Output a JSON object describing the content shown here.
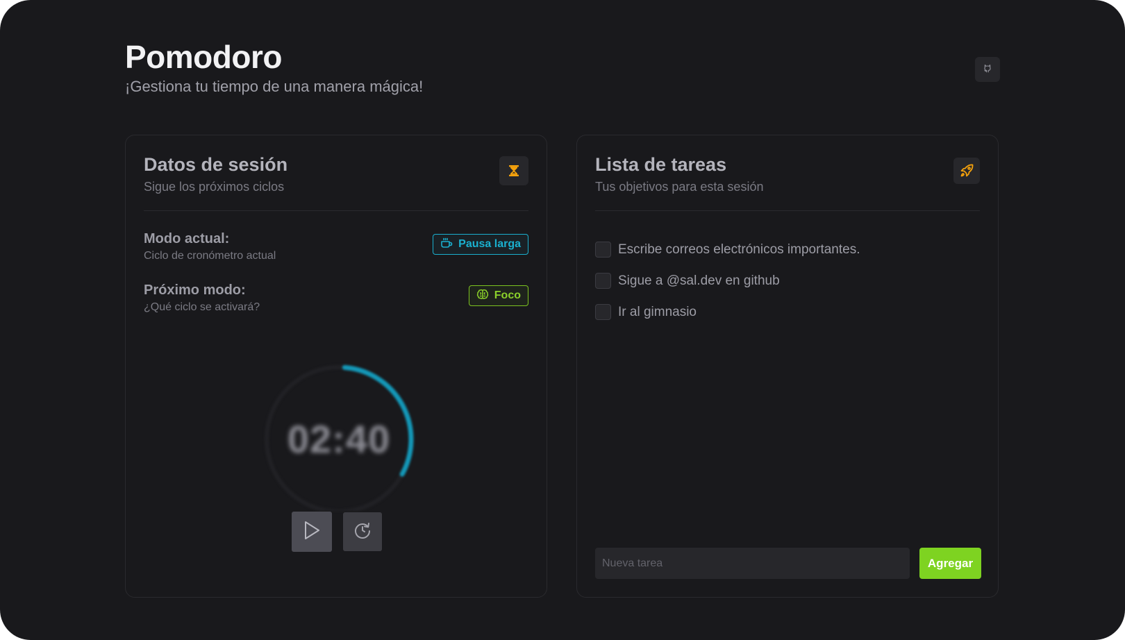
{
  "header": {
    "title": "Pomodoro",
    "subtitle": "¡Gestiona tu tiempo de una manera mágica!",
    "github_icon": "github-icon"
  },
  "session": {
    "title": "Datos de sesión",
    "subtitle": "Sigue los próximos ciclos",
    "icon": "hourglass-icon",
    "current_mode": {
      "label": "Modo actual:",
      "description": "Ciclo de cronómetro actual",
      "badge": "Pausa larga",
      "badge_icon": "coffee-icon",
      "badge_color": "#1ab0cf"
    },
    "next_mode": {
      "label": "Próximo modo:",
      "description": "¿Qué ciclo se activará?",
      "badge": "Foco",
      "badge_icon": "brain-icon",
      "badge_color": "#7dc41f"
    },
    "timer": {
      "display": "02:40",
      "progress": 0.33,
      "ring_color": "#1498b8"
    },
    "controls": {
      "play_icon": "play-icon",
      "reset_icon": "reset-icon"
    }
  },
  "tasks": {
    "title": "Lista de tareas",
    "subtitle": "Tus objetivos para esta sesión",
    "icon": "rocket-icon",
    "items": [
      {
        "label": "Escribe correos electrónicos importantes.",
        "done": false
      },
      {
        "label": "Sigue a @sal.dev en github",
        "done": false
      },
      {
        "label": "Ir al gimnasio",
        "done": false
      }
    ],
    "input_placeholder": "Nueva tarea",
    "add_label": "Agregar",
    "accent": "#7ed321"
  }
}
